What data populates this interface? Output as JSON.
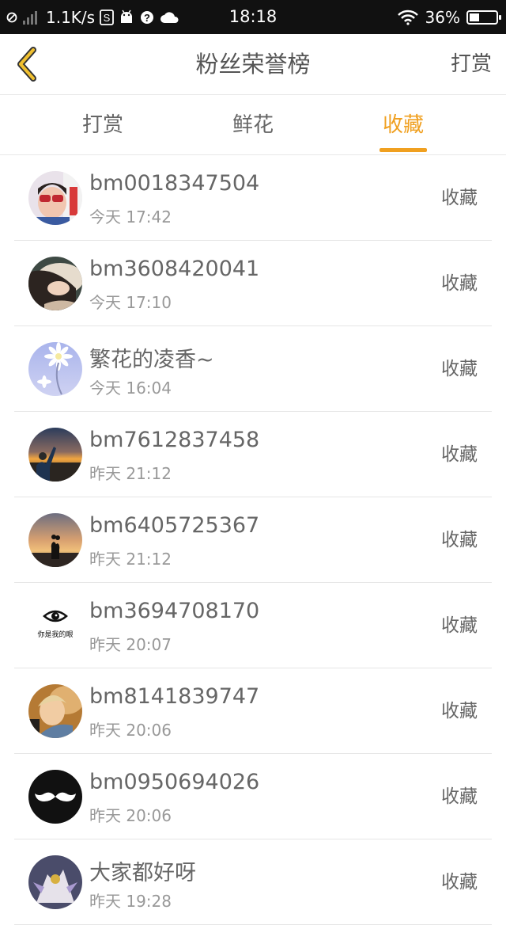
{
  "status_bar": {
    "net_speed": "1.1K/s",
    "time": "18:18",
    "battery": "36%",
    "battery_level": 0.36,
    "icons": [
      "no-sim-icon",
      "signal-icon",
      "sim-s-icon",
      "android-debug-icon",
      "question-icon",
      "cloud-icon",
      "wifi-icon",
      "battery-icon"
    ]
  },
  "header": {
    "title": "粉丝荣誉榜",
    "action": "打赏"
  },
  "tabs": [
    {
      "label": "打赏",
      "active": false
    },
    {
      "label": "鲜花",
      "active": false
    },
    {
      "label": "收藏",
      "active": true
    }
  ],
  "accent_color": "#f0a020",
  "list": [
    {
      "name": "bm0018347504",
      "time": "今天 17:42",
      "action": "收藏",
      "avatar": "boy-sunglasses"
    },
    {
      "name": "bm3608420041",
      "time": "今天 17:10",
      "action": "收藏",
      "avatar": "girl-photo"
    },
    {
      "name": "繁花的凌香~",
      "time": "今天 16:04",
      "action": "收藏",
      "avatar": "daisy-flower"
    },
    {
      "name": "bm7612837458",
      "time": "昨天 21:12",
      "action": "收藏",
      "avatar": "sunset-person"
    },
    {
      "name": "bm6405725367",
      "time": "昨天 21:12",
      "action": "收藏",
      "avatar": "sunset-couple"
    },
    {
      "name": "bm3694708170",
      "time": "昨天 20:07",
      "action": "收藏",
      "avatar": "eye",
      "avatar_caption": "你是我的眼"
    },
    {
      "name": "bm8141839747",
      "time": "昨天 20:06",
      "action": "收藏",
      "avatar": "boy-photo"
    },
    {
      "name": "bm0950694026",
      "time": "昨天 20:06",
      "action": "收藏",
      "avatar": "mustache"
    },
    {
      "name": "大家都好呀",
      "time": "昨天 19:28",
      "action": "收藏",
      "avatar": "anime-character"
    }
  ]
}
